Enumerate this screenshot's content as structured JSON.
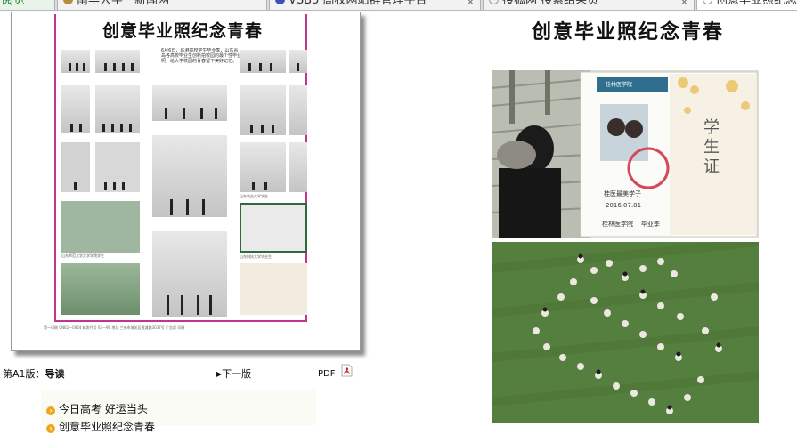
{
  "browser": {
    "tabs": [
      {
        "label": "开阅览",
        "favicon_color": "#2a9a3a"
      },
      {
        "label": "南华大学－新闻网",
        "favicon_color": "#b48d3f"
      },
      {
        "label": "VSB5 高校网站群管理平台",
        "favicon_color": "#3b4fb8"
      },
      {
        "label": "搜狐网 搜索结果页",
        "favicon_color": "#e8e8e8"
      },
      {
        "label": "创意毕业照纪念青春",
        "favicon_color": "#ffffff"
      }
    ]
  },
  "paper": {
    "title": "创意毕业照纪念青春",
    "intro": "6月6日，珠港高校学生毕业季，山东青岛各高校毕业生创新拍校园的最个性毕业照，给大学校园的青春留下美好记忆。",
    "captions": [
      "山东师范大学文学学院学生",
      "山东农业大学学生",
      "山东科技大学毕业生",
      "青岛理工大学毕业生"
    ],
    "footer": "第一印刷 CN62—0024   邮发代号 03—96   地址 兰州市城关区雁滩路3037号 广告部 印刷"
  },
  "article": {
    "title": "创意毕业照纪念青春",
    "photo1": {
      "card_header": "桂林医学院",
      "card_title": "学生证",
      "card_name": "桂医最美学子",
      "card_date": "2016.07.01",
      "card_footer": "桂林医学院    毕业季"
    }
  },
  "nav": {
    "edition_prefix": "第A1版：",
    "edition_name": "导读",
    "next_label": "下一版",
    "pdf_label": "PDF"
  },
  "headlines": [
    {
      "label": "今日高考  好运当头"
    },
    {
      "label": "创意毕业照纪念青春"
    }
  ],
  "colors": {
    "accent_frame": "#c2358c",
    "bullet": "#f0a418",
    "pdf_red": "#d22b2b"
  }
}
